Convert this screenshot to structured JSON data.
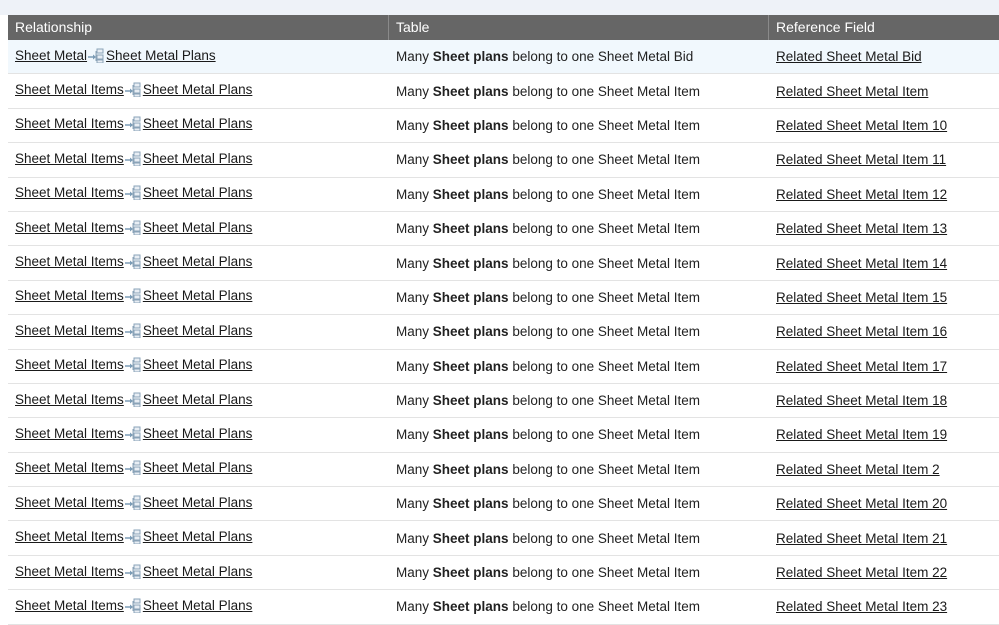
{
  "header": {
    "relationship": "Relationship",
    "table": "Table",
    "reference_field": "Reference Field"
  },
  "desc": {
    "prefix": "Many",
    "bold": "Sheet plans",
    "middle": "belong to one"
  },
  "rows": [
    {
      "parent": "Sheet Metal",
      "child": "Sheet Metal Plans",
      "target": "Sheet Metal Bid",
      "field": "Related Sheet Metal Bid"
    },
    {
      "parent": "Sheet Metal Items",
      "child": "Sheet Metal Plans",
      "target": "Sheet Metal Item",
      "field": "Related Sheet Metal Item"
    },
    {
      "parent": "Sheet Metal Items",
      "child": "Sheet Metal Plans",
      "target": "Sheet Metal Item",
      "field": "Related Sheet Metal Item 10"
    },
    {
      "parent": "Sheet Metal Items",
      "child": "Sheet Metal Plans",
      "target": "Sheet Metal Item",
      "field": "Related Sheet Metal Item 11"
    },
    {
      "parent": "Sheet Metal Items",
      "child": "Sheet Metal Plans",
      "target": "Sheet Metal Item",
      "field": "Related Sheet Metal Item 12"
    },
    {
      "parent": "Sheet Metal Items",
      "child": "Sheet Metal Plans",
      "target": "Sheet Metal Item",
      "field": "Related Sheet Metal Item 13"
    },
    {
      "parent": "Sheet Metal Items",
      "child": "Sheet Metal Plans",
      "target": "Sheet Metal Item",
      "field": "Related Sheet Metal Item 14"
    },
    {
      "parent": "Sheet Metal Items",
      "child": "Sheet Metal Plans",
      "target": "Sheet Metal Item",
      "field": "Related Sheet Metal Item 15"
    },
    {
      "parent": "Sheet Metal Items",
      "child": "Sheet Metal Plans",
      "target": "Sheet Metal Item",
      "field": "Related Sheet Metal Item 16"
    },
    {
      "parent": "Sheet Metal Items",
      "child": "Sheet Metal Plans",
      "target": "Sheet Metal Item",
      "field": "Related Sheet Metal Item 17"
    },
    {
      "parent": "Sheet Metal Items",
      "child": "Sheet Metal Plans",
      "target": "Sheet Metal Item",
      "field": "Related Sheet Metal Item 18"
    },
    {
      "parent": "Sheet Metal Items",
      "child": "Sheet Metal Plans",
      "target": "Sheet Metal Item",
      "field": "Related Sheet Metal Item 19"
    },
    {
      "parent": "Sheet Metal Items",
      "child": "Sheet Metal Plans",
      "target": "Sheet Metal Item",
      "field": "Related Sheet Metal Item 2"
    },
    {
      "parent": "Sheet Metal Items",
      "child": "Sheet Metal Plans",
      "target": "Sheet Metal Item",
      "field": "Related Sheet Metal Item 20"
    },
    {
      "parent": "Sheet Metal Items",
      "child": "Sheet Metal Plans",
      "target": "Sheet Metal Item",
      "field": "Related Sheet Metal Item 21"
    },
    {
      "parent": "Sheet Metal Items",
      "child": "Sheet Metal Plans",
      "target": "Sheet Metal Item",
      "field": "Related Sheet Metal Item 22"
    },
    {
      "parent": "Sheet Metal Items",
      "child": "Sheet Metal Plans",
      "target": "Sheet Metal Item",
      "field": "Related Sheet Metal Item 23"
    }
  ],
  "icons": {
    "relationship": "relationship-arrow-icon"
  },
  "colors": {
    "header_bg": "#666666",
    "selected_row_bg": "#f1f8fd"
  }
}
